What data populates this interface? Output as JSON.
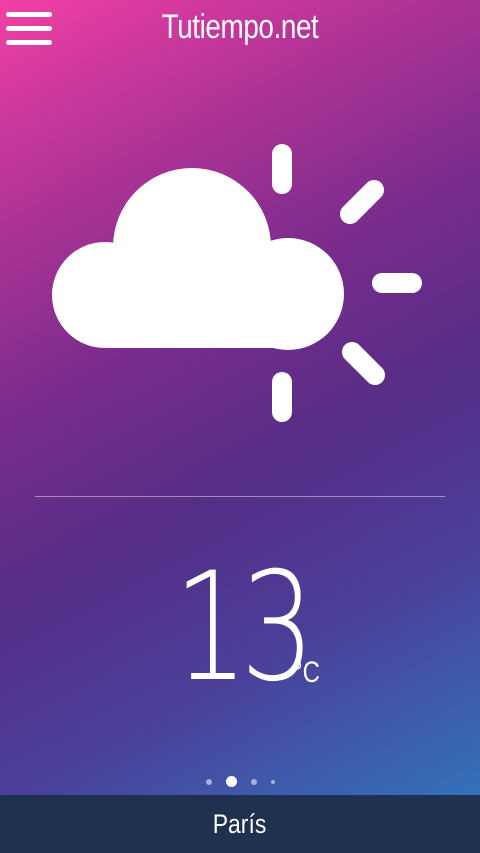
{
  "header": {
    "title": "Tutiempo.net",
    "menu_icon": "hamburger-menu-icon"
  },
  "weather": {
    "icon": "partly-cloudy-day-icon",
    "temperature": "13",
    "unit": "°C"
  },
  "pager": {
    "page_count": 4,
    "active_index": 1
  },
  "location": {
    "city": "París"
  },
  "colors": {
    "gradient_top_left": "#f23fa6",
    "gradient_middle": "#552d87",
    "gradient_bottom_right": "#2e7cc2",
    "bottom_bar": "#1f3050",
    "foreground": "#ffffff"
  }
}
